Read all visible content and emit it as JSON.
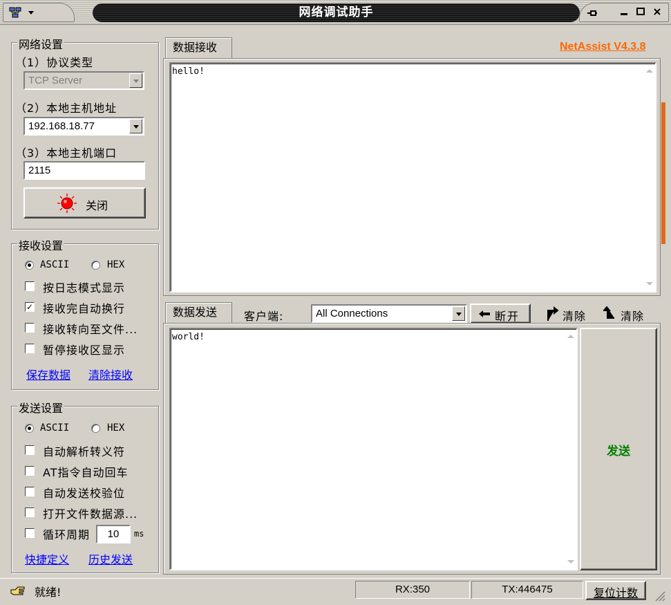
{
  "window": {
    "title": "网络调试助手",
    "brand": "NetAssist V4.3.8"
  },
  "network_settings": {
    "title": "网络设置",
    "protocol_label": "（1）协议类型",
    "protocol_value": "TCP Server",
    "host_label": "（2）本地主机地址",
    "host_value": "192.168.18.77",
    "port_label": "（3）本地主机端口",
    "port_value": "2115",
    "close_button": "关闭"
  },
  "receive_settings": {
    "title": "接收设置",
    "ascii": "ASCII",
    "hex": "HEX",
    "options": [
      {
        "label": "按日志模式显示",
        "checked": false
      },
      {
        "label": "接收完自动换行",
        "checked": true
      },
      {
        "label": "接收转向至文件...",
        "checked": false
      },
      {
        "label": "暂停接收区显示",
        "checked": false
      }
    ],
    "save_link": "保存数据",
    "clear_link": "清除接收"
  },
  "send_settings": {
    "title": "发送设置",
    "ascii": "ASCII",
    "hex": "HEX",
    "options": [
      {
        "label": "自动解析转义符",
        "checked": false
      },
      {
        "label": "AT指令自动回车",
        "checked": false
      },
      {
        "label": "自动发送校验位",
        "checked": false
      },
      {
        "label": "打开文件数据源...",
        "checked": false
      }
    ],
    "cycle_label": "循环周期",
    "cycle_value": "10",
    "cycle_unit": "ms",
    "shortcut_link": "快捷定义",
    "history_link": "历史发送"
  },
  "receive_panel": {
    "tab": "数据接收",
    "content": "hello!"
  },
  "send_panel": {
    "tab": "数据发送",
    "client_label": "客户端:",
    "client_value": "All Connections",
    "disconnect_button": "断开",
    "clear1": "清除",
    "clear2": "清除",
    "content": "world!",
    "send_button": "发送"
  },
  "status": {
    "text": "就绪!",
    "rx": "RX:350",
    "tx": "TX:446475",
    "reset_button": "复位计数"
  },
  "colors": {
    "brand": "#ff6600",
    "send": "#008000",
    "link": "#0000ff",
    "accent_scroll": "#e06a1a"
  }
}
